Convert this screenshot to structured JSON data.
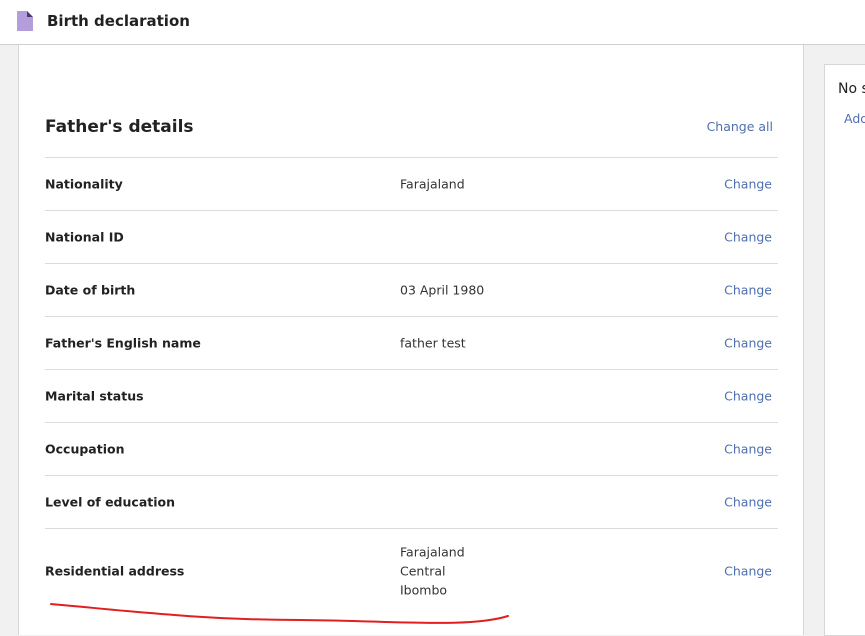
{
  "app": {
    "title": "Birth declaration",
    "icon": "document-icon"
  },
  "section": {
    "title": "Father's details",
    "change_all": "Change all"
  },
  "rows": [
    {
      "label": "Nationality",
      "value": "Farajaland",
      "action": "Change"
    },
    {
      "label": "National ID",
      "value": "",
      "action": "Change"
    },
    {
      "label": "Date of birth",
      "value": "03 April 1980",
      "action": "Change"
    },
    {
      "label": "Father's English name",
      "value": "father test",
      "action": "Change"
    },
    {
      "label": "Marital status",
      "value": "",
      "action": "Change"
    },
    {
      "label": "Occupation",
      "value": "",
      "action": "Change"
    },
    {
      "label": "Level of education",
      "value": "",
      "action": "Change"
    },
    {
      "label": "Residential address",
      "value_lines": [
        "Farajaland",
        "Central",
        "Ibombo"
      ],
      "action": "Change"
    }
  ],
  "side": {
    "title": "No s",
    "link": "Add"
  },
  "colors": {
    "accent": "#4f6fb0",
    "icon": "#b39ddb",
    "scribble": "#e02020"
  }
}
